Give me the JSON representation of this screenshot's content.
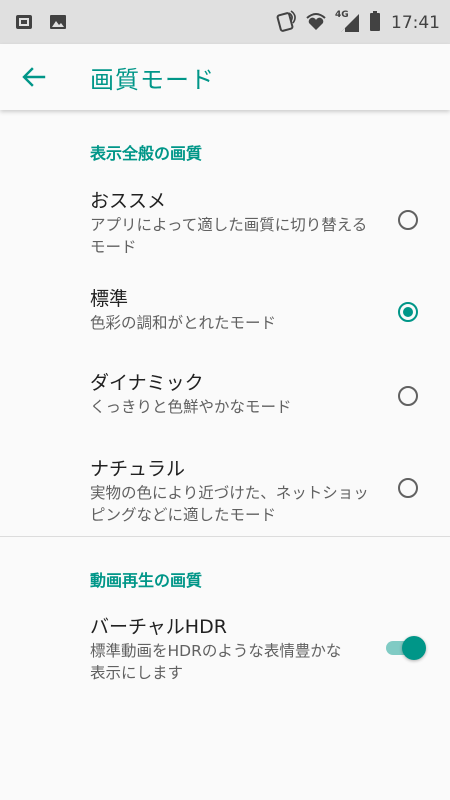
{
  "status_bar": {
    "time": "17:41",
    "network": "4G",
    "icons": [
      "notification-card-icon",
      "image-icon",
      "nfc-icon",
      "wifi-heart-icon",
      "signal-icon",
      "battery-icon"
    ]
  },
  "header": {
    "title": "画質モード",
    "back_icon": "arrow-back-icon"
  },
  "sections": [
    {
      "title": "表示全般の画質",
      "options": [
        {
          "title": "おススメ",
          "subtitle": "アプリによって適した画質に切り替えるモード",
          "selected": false
        },
        {
          "title": "標準",
          "subtitle": "色彩の調和がとれたモード",
          "selected": true
        },
        {
          "title": "ダイナミック",
          "subtitle": "くっきりと色鮮やかなモード",
          "selected": false
        },
        {
          "title": "ナチュラル",
          "subtitle": "実物の色により近づけた、ネットショッピングなどに適したモード",
          "selected": false
        }
      ]
    },
    {
      "title": "動画再生の画質",
      "toggle_item": {
        "title": "バーチャルHDR",
        "subtitle": "標準動画をHDRのような表情豊かな表示にします",
        "enabled": true
      }
    }
  ],
  "colors": {
    "accent": "#009688",
    "accent_light": "#80cbc4",
    "status_bar_bg": "#e0e0e0",
    "background": "#fafafa"
  }
}
